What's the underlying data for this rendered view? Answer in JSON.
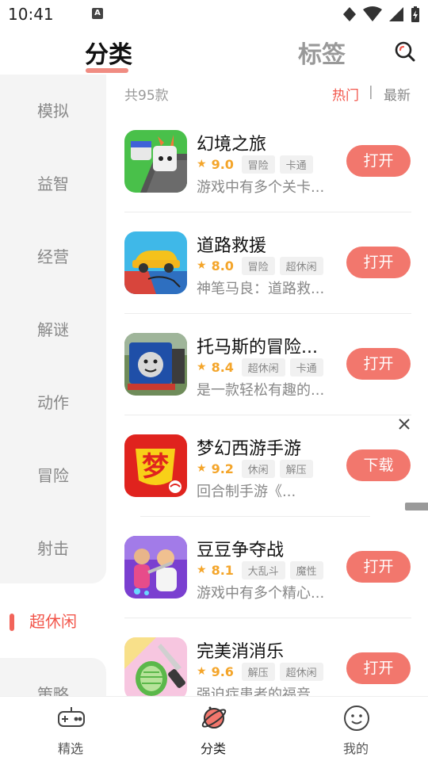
{
  "status_bar": {
    "time": "10:41",
    "notification_letter": "A"
  },
  "top_tabs": {
    "category": "分类",
    "tags": "标签"
  },
  "sidebar": {
    "items": [
      {
        "label": "模拟"
      },
      {
        "label": "益智"
      },
      {
        "label": "经营"
      },
      {
        "label": "解谜"
      },
      {
        "label": "动作"
      },
      {
        "label": "冒险"
      },
      {
        "label": "射击"
      },
      {
        "label": "超休闲"
      },
      {
        "label": "策略"
      }
    ],
    "active_index": 7
  },
  "list_header": {
    "count": "共95款",
    "sort_hot": "热门",
    "sort_separator": "|",
    "sort_new": "最新"
  },
  "apps": [
    {
      "name": "幻境之旅",
      "rating": "9.0",
      "tags": [
        "冒险",
        "卡通"
      ],
      "desc": "游戏中有多个关卡...",
      "button": "打开"
    },
    {
      "name": "道路救援",
      "rating": "8.0",
      "tags": [
        "冒险",
        "超休闲"
      ],
      "desc": "神笔马良：道路救...",
      "button": "打开"
    },
    {
      "name": "托马斯的冒险...",
      "rating": "8.4",
      "tags": [
        "超休闲",
        "卡通"
      ],
      "desc": "是一款轻松有趣的...",
      "button": "打开"
    },
    {
      "name": "梦幻西游手游",
      "rating": "9.2",
      "tags": [
        "休闲",
        "解压"
      ],
      "desc": "回合制手游《...",
      "button": "下载",
      "is_ad": true
    },
    {
      "name": "豆豆争夺战",
      "rating": "8.1",
      "tags": [
        "大乱斗",
        "魔性"
      ],
      "desc": "游戏中有多个精心...",
      "button": "打开"
    },
    {
      "name": "完美消消乐",
      "rating": "9.6",
      "tags": [
        "解压",
        "超休闲"
      ],
      "desc": "强迫症患者的福音...",
      "button": "打开"
    }
  ],
  "bottom_nav": {
    "items": [
      {
        "label": "精选",
        "icon": "gamepad-icon"
      },
      {
        "label": "分类",
        "icon": "planet-icon"
      },
      {
        "label": "我的",
        "icon": "smiley-icon"
      }
    ],
    "active_index": 1
  },
  "colors": {
    "accent": "#f2776d",
    "active_text": "#f2564b",
    "rating": "#f4a52a",
    "underline": "#f08c82"
  }
}
